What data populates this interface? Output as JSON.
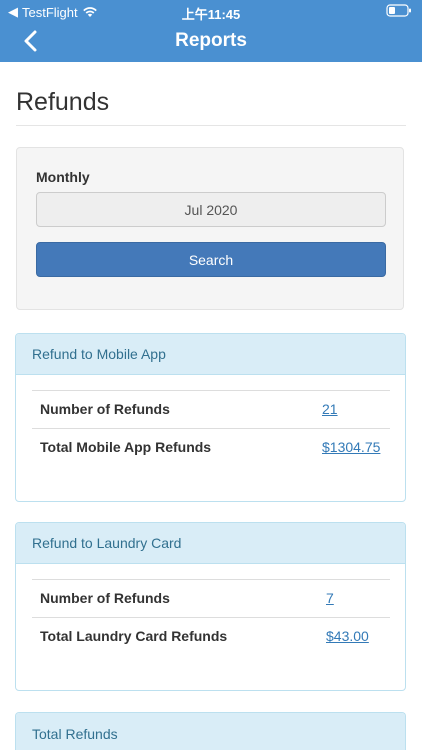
{
  "status_bar": {
    "back_app": "TestFlight",
    "time": "上午11:45"
  },
  "nav": {
    "title": "Reports"
  },
  "page": {
    "title": "Refunds"
  },
  "filter": {
    "label": "Monthly",
    "selected_month": "Jul 2020",
    "search_label": "Search"
  },
  "mobile_app": {
    "heading": "Refund to Mobile App",
    "rows": [
      {
        "label": "Number of Refunds",
        "value": "21"
      },
      {
        "label": "Total Mobile App Refunds",
        "value": "$1304.75"
      }
    ]
  },
  "laundry_card": {
    "heading": "Refund to Laundry Card",
    "rows": [
      {
        "label": "Number of Refunds",
        "value": "7"
      },
      {
        "label": "Total Laundry Card Refunds",
        "value": "$43.00"
      }
    ]
  },
  "total_refunds": {
    "heading": "Total Refunds"
  },
  "colors": {
    "header": "#4a90d1",
    "button": "#4479b9",
    "panel_heading_bg": "#d9edf7",
    "panel_heading_text": "#31708f",
    "link": "#337ab7"
  }
}
